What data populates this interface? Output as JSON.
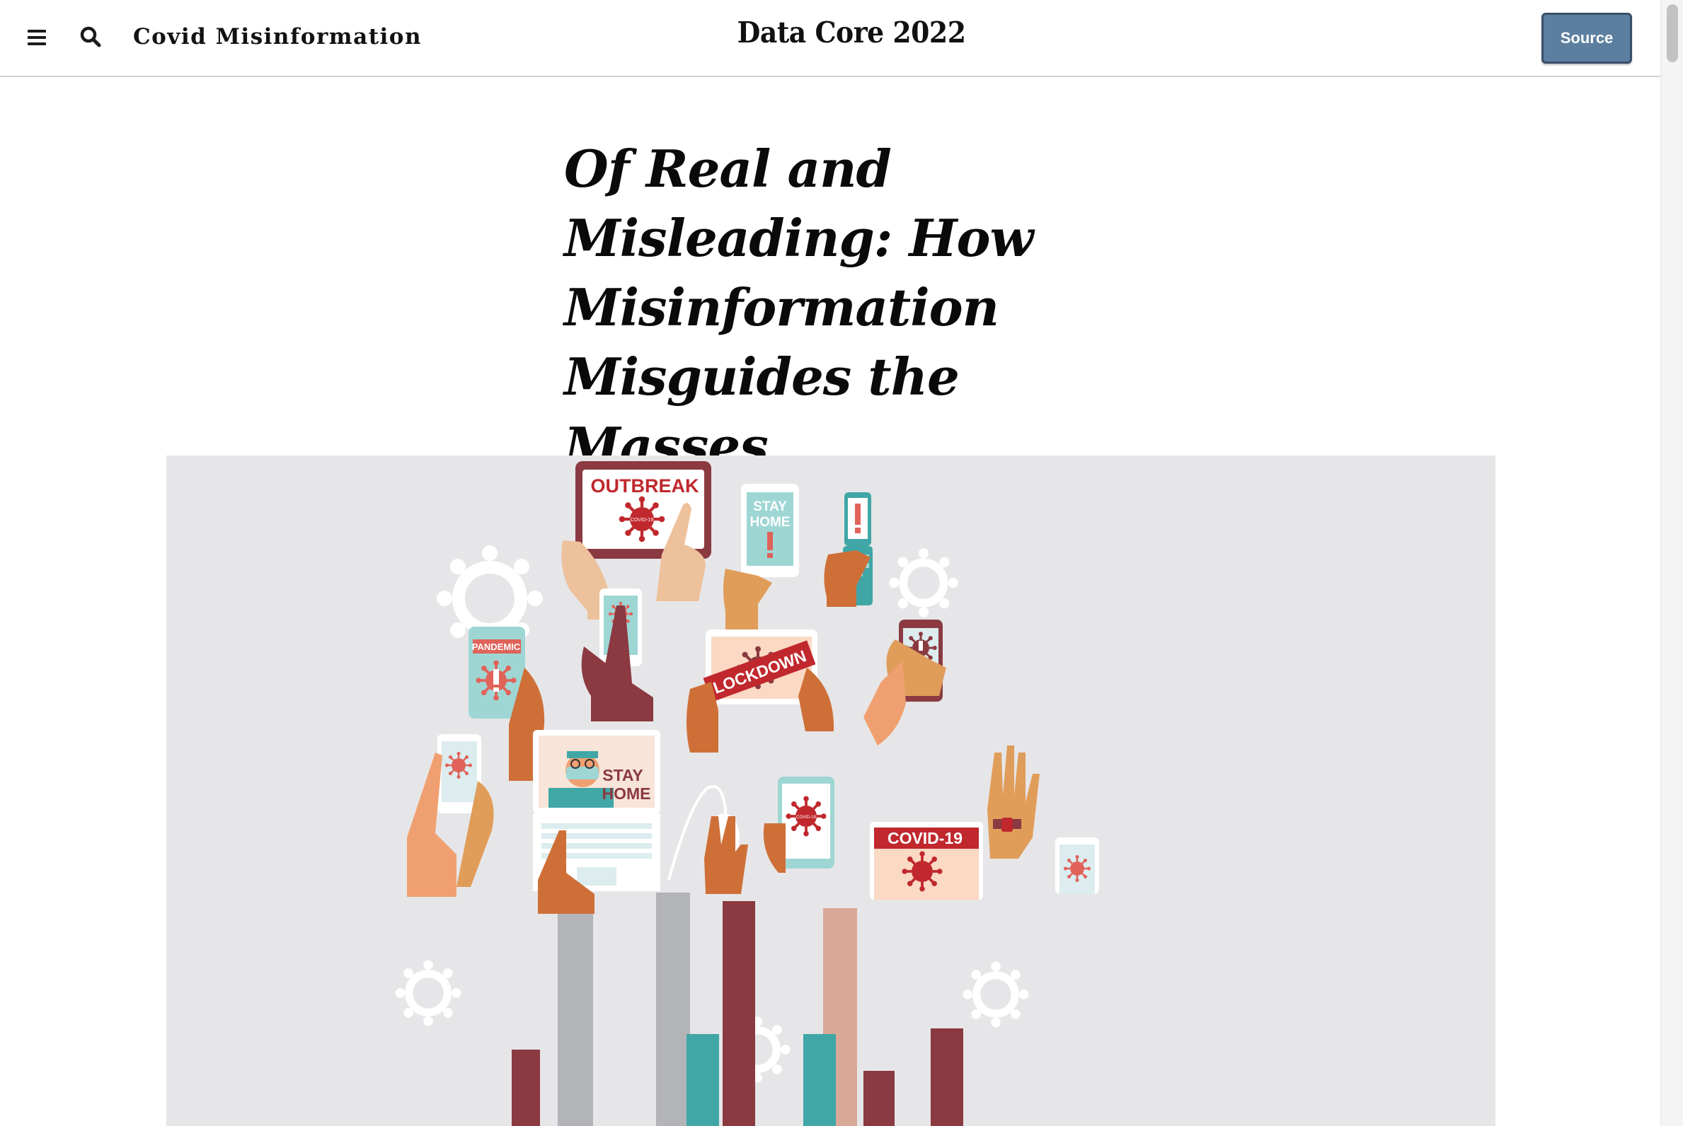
{
  "header": {
    "menu_icon": "hamburger-menu-icon",
    "search_icon": "search-icon",
    "section_title": "Covid Misinformation",
    "site_title": "Data Core 2022",
    "source_button": "Source"
  },
  "article": {
    "headline": "Of Real and Misleading: How Misinformation Misguides the Masses"
  },
  "hero_illustration": {
    "sign_labels": {
      "outbreak": "OUTBREAK",
      "stay_home_top": [
        "STAY",
        "HOME"
      ],
      "pandemic": "PANDEMIC",
      "lockdown": "LOCKDOWN",
      "stay_home_laptop": [
        "STAY",
        "HOME"
      ],
      "covid_banner": "COVID-19",
      "virus_tag": "COVID-19"
    },
    "colors": {
      "background": "#e6e6e8",
      "red": "#c0282d",
      "teal": "#40a6a6",
      "maroon": "#8a3a40",
      "light_teal": "#9ed6d4"
    }
  },
  "colors": {
    "source_button": "#5c7fa0",
    "header_border": "#d4d4d4"
  }
}
